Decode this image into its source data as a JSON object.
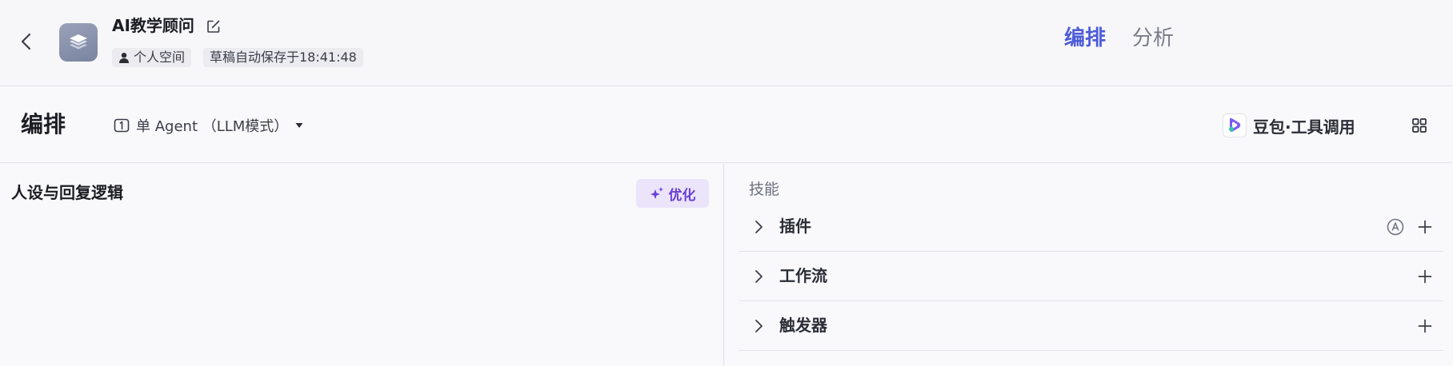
{
  "header": {
    "bot_name": "AI教学顾问",
    "workspace_tag": "个人空间",
    "draft_status": "草稿自动保存于18:41:48",
    "tabs": [
      {
        "label": "编排",
        "active": true
      },
      {
        "label": "分析",
        "active": false
      }
    ],
    "icons": {
      "back": "chevron-left-icon",
      "avatar": "layers-icon",
      "edit": "edit-icon",
      "workspace": "user-icon"
    }
  },
  "toolbar": {
    "section_title": "编排",
    "mode_label": "单 Agent （LLM模式）",
    "model_label": "豆包·工具调用",
    "icons": {
      "mode": "agent-mode-icon",
      "mode_dropdown": "caret-down-icon",
      "model": "doubao-logo-icon",
      "layout": "layout-grid-icon"
    }
  },
  "prompt_panel": {
    "title": "人设与回复逻辑",
    "optimize_label": "优化",
    "optimize_icon": "sparkle-icon"
  },
  "skills_panel": {
    "heading": "技能",
    "rows": [
      {
        "label": "插件",
        "has_auto_toggle": true
      },
      {
        "label": "工作流",
        "has_auto_toggle": false
      },
      {
        "label": "触发器",
        "has_auto_toggle": false
      }
    ],
    "auto_icon_letter": "A"
  },
  "colors": {
    "accent": "#4e5bd9",
    "optimize_bg": "#ebe4fb",
    "optimize_text": "#6a3fd9",
    "border": "#e1e2e8",
    "muted_text": "#7a7d88"
  }
}
